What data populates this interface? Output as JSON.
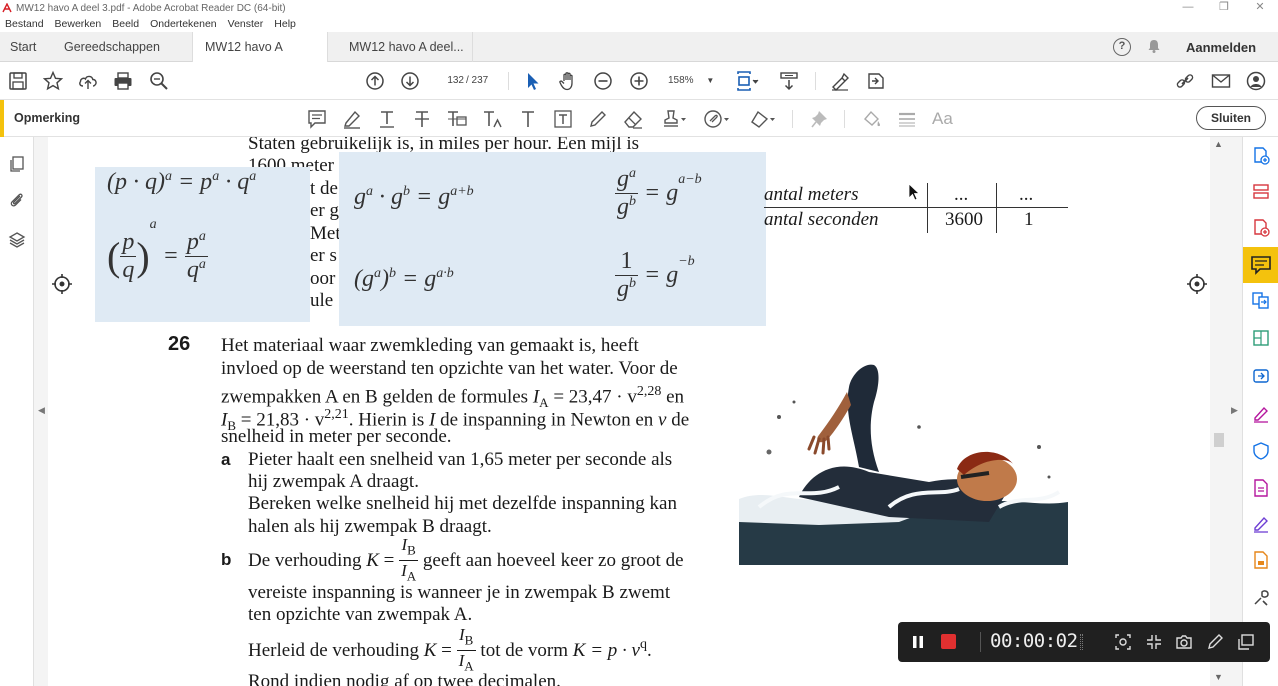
{
  "window": {
    "title": "MW12 havo A deel 3.pdf - Adobe Acrobat Reader DC (64-bit)"
  },
  "menu": [
    "Bestand",
    "Bewerken",
    "Beeld",
    "Ondertekenen",
    "Venster",
    "Help"
  ],
  "tabs": {
    "start": "Start",
    "tools": "Gereedschappen",
    "doc1": "MW12 havo A deel...",
    "doc1_close": "×",
    "doc2": "MW12 havo A deel...",
    "help_icon": "?",
    "signin": "Aanmelden"
  },
  "toolbar": {
    "current_page": "132",
    "page_total": "/ 237",
    "zoom": "158%"
  },
  "commentbar": {
    "label": "Opmerking",
    "close": "Sluiten",
    "text_tool": "Aa"
  },
  "document": {
    "top_line": "Staten gebruikelijk is, in miles per hour. Een mijl is",
    "partial_lines": [
      "1600 meter",
      "t de",
      "er ge",
      "Met",
      "er s",
      "oor",
      "ule"
    ],
    "formulas": {
      "f1": "(p · q)",
      "f1_exp": "a",
      "f1_rhs": "= p",
      "f1_rhs_exp1": "a",
      "f1_rhs_mid": " · q",
      "f1_rhs_exp2": "a",
      "f2_num": "p",
      "f2_den": "q",
      "f2_exp": "a",
      "f2_rnum": "p",
      "f2_rnum_exp": "a",
      "f2_rden": "q",
      "f2_rden_exp": "a",
      "f3": "g",
      "f3_e1": "a",
      "f3_mid": " · g",
      "f3_e2": "b",
      "f3_eq": " = g",
      "f3_e3": "a+b",
      "f4": "(g",
      "f4_e1": "a",
      "f4_mid": ")",
      "f4_e2": "b",
      "f4_eq": " = g",
      "f4_e3": "a·b",
      "f5_num": "g",
      "f5_num_exp": "a",
      "f5_den": "g",
      "f5_den_exp": "b",
      "f5_eq": "= g",
      "f5_e": "a−b",
      "f6_num": "1",
      "f6_den": "g",
      "f6_den_exp": "b",
      "f6_eq": "= g",
      "f6_e": "−b"
    },
    "table": {
      "row1_label": "antal meters",
      "row1_c1": "...",
      "row1_c2": "...",
      "row2_label": "antal seconden",
      "row2_c1": "3600",
      "row2_c2": "1"
    },
    "question": {
      "number": "26",
      "lines": [
        "Het materiaal waar zwemkleding van gemaakt is, heeft",
        "invloed op de weerstand ten opzichte van het water. Voor de"
      ],
      "formula_line_a": "zwempakken A en B gelden de formules ",
      "formula_line_b": ". Hierin is ",
      "formula_line_c": " de inspanning in Newton en ",
      "formula_line_d": " de",
      "IA": "I",
      "IA_sub": "A",
      "IA_rhs": " = 23,47 · v",
      "IA_exp": "2,28",
      "en": " en",
      "IB": "I",
      "IB_sub": "B",
      "IB_rhs": " = 21,83 · v",
      "IB_exp": "2,21",
      "I": "I",
      "v": "v",
      "last_line": "snelheid in meter per seconde.",
      "a_label": "a",
      "a_lines": [
        "Pieter haalt een snelheid van 1,65 meter per seconde als",
        "hij zwempak A draagt.",
        "Bereken welke snelheid hij met dezelfde inspanning kan",
        "halen als hij zwempak B draagt."
      ],
      "b_label": "b",
      "b_pre": "De verhouding ",
      "b_K": "K",
      "b_eq": " = ",
      "b_num": "I",
      "b_num_sub": "B",
      "b_den": "I",
      "b_den_sub": "A",
      "b_post": " geeft aan hoeveel keer zo groot de",
      "b_lines": [
        "vereiste inspanning is wanneer je in zwempak B zwemt",
        "ten opzichte van zwempak A."
      ],
      "b2_pre": "Herleid de verhouding ",
      "b2_post": " tot de vorm ",
      "b2_form": "K = p · v",
      "b2_exp": "q",
      "b2_dot": ".",
      "b_last": "Rond indien nodig af op twee decimalen."
    }
  },
  "recorder": {
    "time": "00:00:02"
  }
}
